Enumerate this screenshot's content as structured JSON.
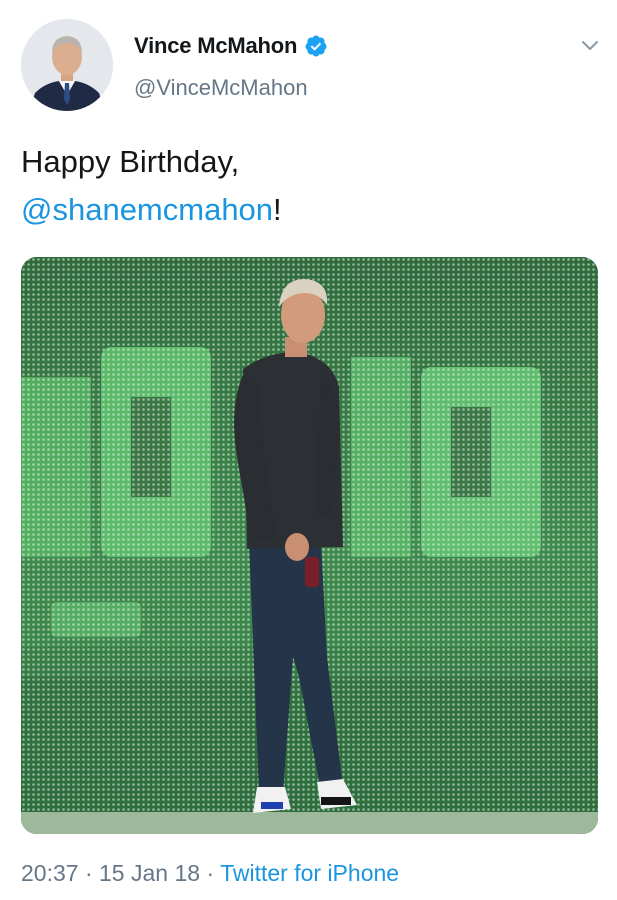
{
  "tweet": {
    "author": {
      "display_name": "Vince McMahon",
      "handle": "@VinceMcMahon",
      "verified": true,
      "avatar_icon": "avatar-photo"
    },
    "text_prefix": "Happy Birthday,",
    "mention": "@shanemcmahon",
    "text_suffix": "!",
    "media": {
      "description_icon": "photo-man-on-stage"
    },
    "time": "20:37",
    "date": "15 Jan 18",
    "separator": "·",
    "source": "Twitter for iPhone"
  },
  "colors": {
    "link": "#1b95e0",
    "secondary_text": "#657786",
    "primary_text": "#14171a",
    "verified_badge": "#1da1f2"
  }
}
